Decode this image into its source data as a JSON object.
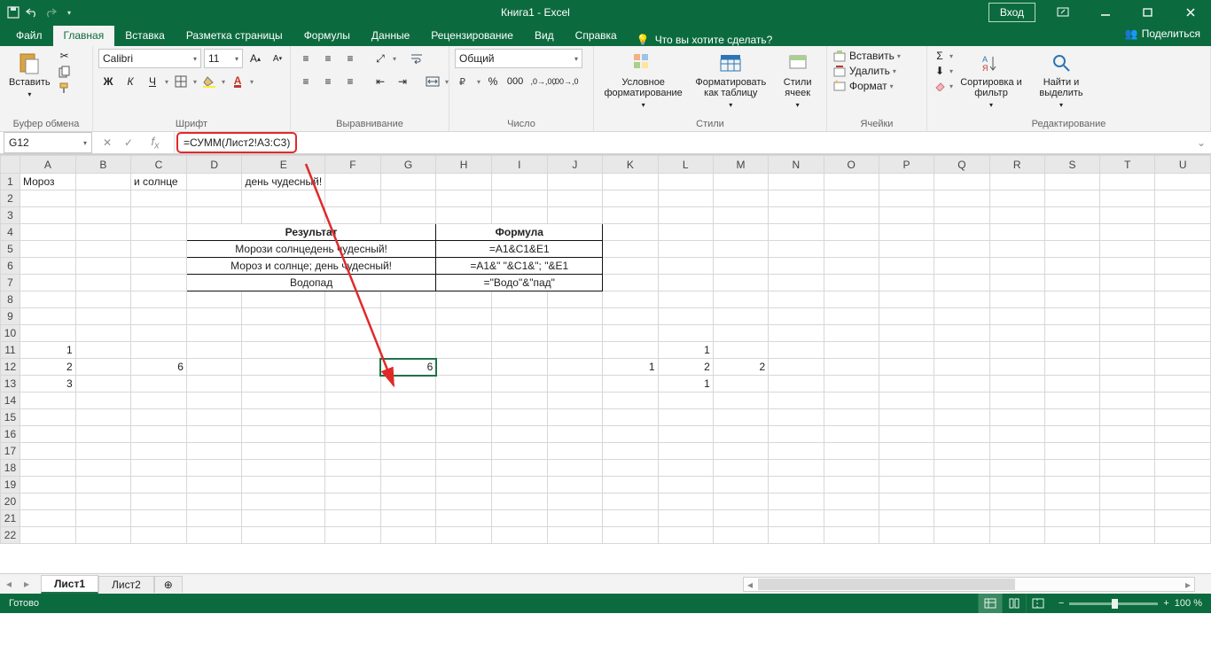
{
  "title": "Книга1  -  Excel",
  "login": "Вход",
  "tabs": {
    "file": "Файл",
    "home": "Главная",
    "insert": "Вставка",
    "pagelayout": "Разметка страницы",
    "formulas": "Формулы",
    "data": "Данные",
    "review": "Рецензирование",
    "view": "Вид",
    "help": "Справка",
    "tellme": "Что вы хотите сделать?"
  },
  "share": "Поделиться",
  "groups": {
    "clipboard": {
      "label": "Буфер обмена",
      "paste": "Вставить"
    },
    "font": {
      "label": "Шрифт",
      "name": "Calibri",
      "size": "11",
      "bold": "Ж",
      "italic": "К",
      "underline": "Ч"
    },
    "align": {
      "label": "Выравнивание"
    },
    "number": {
      "label": "Число",
      "format": "Общий"
    },
    "styles": {
      "label": "Стили",
      "cond": "Условное форматирование",
      "table": "Форматировать как таблицу",
      "cell": "Стили ячеек"
    },
    "cells": {
      "label": "Ячейки",
      "insert": "Вставить",
      "delete": "Удалить",
      "format": "Формат"
    },
    "editing": {
      "label": "Редактирование",
      "sort": "Сортировка и фильтр",
      "find": "Найти и выделить"
    }
  },
  "fbar": {
    "namebox": "G12",
    "formula": "=СУММ(Лист2!A3:C3)"
  },
  "columns": [
    "A",
    "B",
    "C",
    "D",
    "E",
    "F",
    "G",
    "H",
    "I",
    "J",
    "K",
    "L",
    "M",
    "N",
    "O",
    "P",
    "Q",
    "R",
    "S",
    "T",
    "U"
  ],
  "rowcount": 22,
  "cells": {
    "A1": "Мороз",
    "C1": "и солнце",
    "E1": "день чудесный!",
    "E4_header": "Результат",
    "I4_header": "Формула",
    "E5": "Морози солнцедень чудесный!",
    "I5": "=A1&C1&E1",
    "E6": "Мороз и солнце; день чудесный!",
    "I6": "=A1&\" \"&C1&\"; \"&E1",
    "E7": "Водопад",
    "I7": "=\"Водо\"&\"пад\"",
    "A11": "1",
    "A12": "2",
    "A13": "3",
    "C12": "6",
    "G12": "6",
    "K12": "1",
    "L11": "1",
    "L12": "2",
    "L13": "1",
    "M12": "2"
  },
  "sheet_tabs": {
    "active": "Лист1",
    "other": "Лист2"
  },
  "status": {
    "ready": "Готово",
    "zoom": "100 %"
  }
}
